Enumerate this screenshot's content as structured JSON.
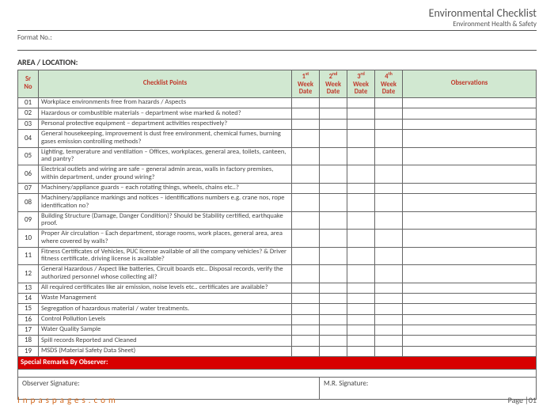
{
  "header": {
    "title": "Environmental Checklist",
    "subtitle": "Environment Health & Safety"
  },
  "format_label": "Format No.:",
  "area_label": "AREA / LOCATION:",
  "columns": {
    "sr": "Sr No",
    "points": "Checklist Points",
    "weeks": [
      "1",
      "2",
      "3",
      "4"
    ],
    "week_suffix": [
      "st",
      "nd",
      "rd",
      "th"
    ],
    "week_line2": "Week",
    "week_line3": "Date",
    "obs": "Observations"
  },
  "rows": [
    {
      "no": "01",
      "text": "Workplace environments free from hazards / Aspects"
    },
    {
      "no": "02",
      "text": "Hazardous or combustible materials – department wise marked & noted?"
    },
    {
      "no": "03",
      "text": "Personal protective equipment – department activities respectively?"
    },
    {
      "no": "04",
      "text": "General housekeeping, improvement is dust free environment, chemical fumes, burning gases emission controlling methods?"
    },
    {
      "no": "05",
      "text": "Lighting, temperature and ventilation – Offices, workplaces, general area, toilets, canteen, and pantry?"
    },
    {
      "no": "06",
      "text": "Electrical outlets and wiring are safe – general admin areas, walls in factory premises, within department, under ground wiring?"
    },
    {
      "no": "07",
      "text": "Machinery/appliance guards – each rotating things, wheels, chains etc..?"
    },
    {
      "no": "08",
      "text": "Machinery/appliance markings and notices – identifications numbers e.g. crane nos, rope identification no?"
    },
    {
      "no": "09",
      "text": "Building Structure (Damage, Danger Condition)? Should be Stability certified, earthquake proof."
    },
    {
      "no": "10",
      "text": "Proper Air circulation – Each department, storage rooms, work places, general area, area where covered by walls?"
    },
    {
      "no": "11",
      "text": "Fitness Certificates of Vehicles, PUC license available of all the company vehicles? & Driver fitness certificate, driving license is available?"
    },
    {
      "no": "12",
      "text": "General Hazardous / Aspect like batteries, Circuit boards etc.. Disposal records, verify the authorized personnel whose collecting all?"
    },
    {
      "no": "13",
      "text": "All required certificates like air emission, noise levels etc.. certificates are available?"
    },
    {
      "no": "14",
      "text": "Waste Management"
    },
    {
      "no": "15",
      "text": "Segregation of hazardous material / water treatments."
    },
    {
      "no": "16",
      "text": "Control Pollution Levels"
    },
    {
      "no": "17",
      "text": "Water Quality Sample"
    },
    {
      "no": "18",
      "text": "Spill records Reported and Cleaned"
    },
    {
      "no": "19",
      "text": "MSDS (Material Safety Data Sheet)"
    }
  ],
  "remarks_label": "Special Remarks By Observer:",
  "sig": {
    "observer": "Observer Signature:",
    "mr": "M.R. Signature:"
  },
  "footer": {
    "brand": "Inpaspages.com",
    "page": "Page |01"
  }
}
